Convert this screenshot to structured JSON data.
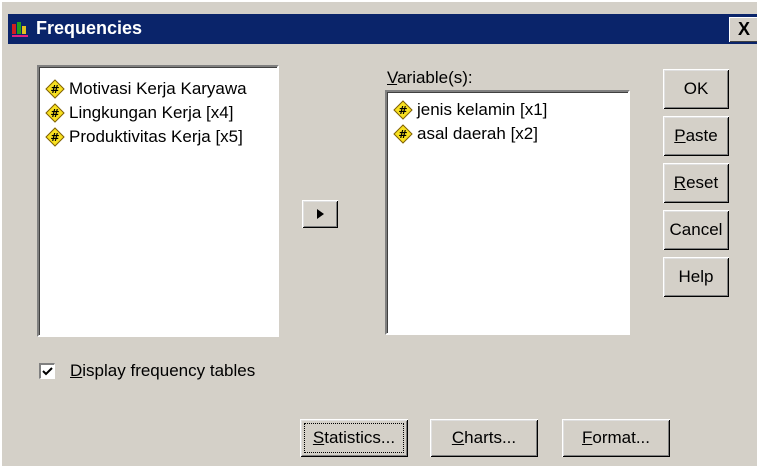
{
  "window": {
    "title": "Frequencies",
    "close_label": "X"
  },
  "source_list": {
    "items": [
      {
        "label": "Motivasi Kerja Karyawa",
        "icon": "numeric-variable-icon"
      },
      {
        "label": "Lingkungan Kerja [x4]",
        "icon": "numeric-variable-icon"
      },
      {
        "label": "Produktivitas Kerja [x5]",
        "icon": "numeric-variable-icon"
      }
    ]
  },
  "move_button": {
    "icon": "arrow-right-icon"
  },
  "variables": {
    "label_prefix": "",
    "label_underline": "V",
    "label_rest": "ariable(s):",
    "items": [
      {
        "label": "jenis kelamin [x1]",
        "icon": "numeric-variable-icon"
      },
      {
        "label": "asal daerah [x2]",
        "icon": "numeric-variable-icon"
      }
    ]
  },
  "buttons": {
    "ok": "OK",
    "paste_u": "P",
    "paste_rest": "aste",
    "reset_u": "R",
    "reset_rest": "eset",
    "cancel": "Cancel",
    "help": "Help"
  },
  "display_tables": {
    "checked": true,
    "u": "D",
    "rest": "isplay frequency tables"
  },
  "bottom_buttons": {
    "statistics_u": "S",
    "statistics_rest": "tatistics...",
    "charts_u": "C",
    "charts_rest": "harts...",
    "format_u": "F",
    "format_rest": "ormat..."
  },
  "colors": {
    "title_bar": "#0a246a",
    "dialog_bg": "#d4d0c8",
    "icon_yellow": "#f8e020"
  }
}
